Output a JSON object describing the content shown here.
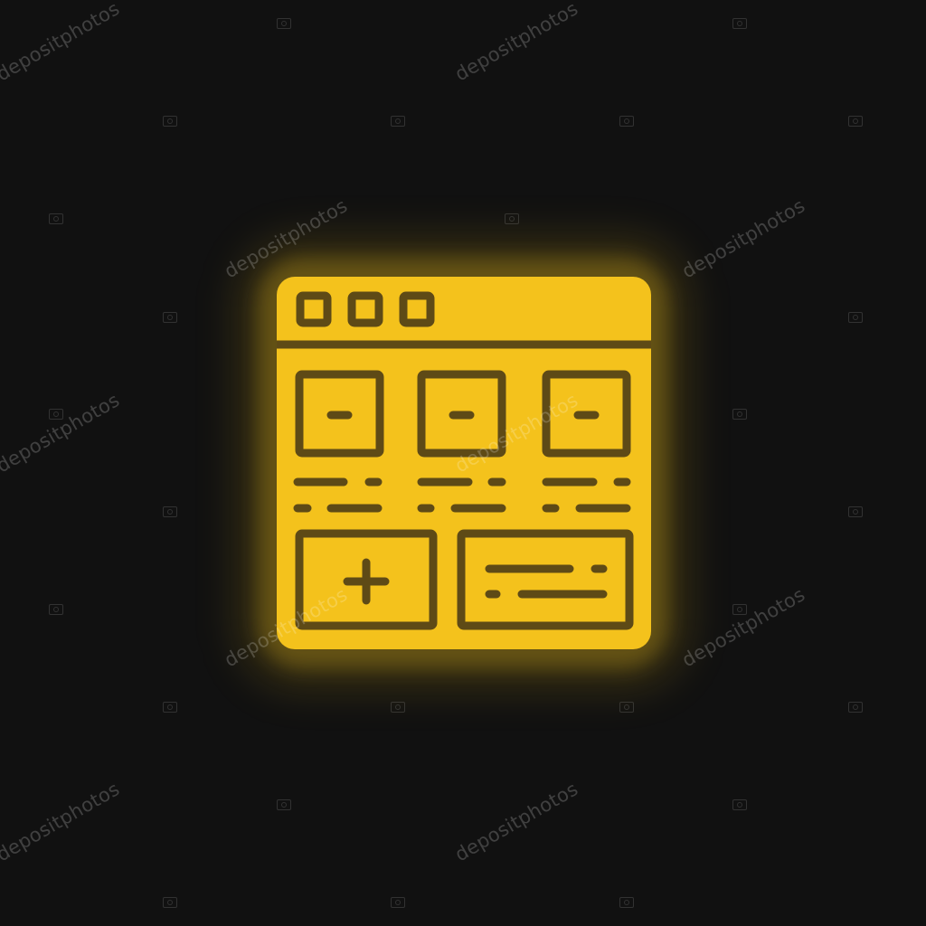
{
  "icon": {
    "name": "web-page-layout-icon",
    "fill_color": "#F4C21C",
    "line_color": "#5E4A16",
    "background_color": "#111111"
  },
  "watermark": {
    "text": "depositphotos"
  }
}
